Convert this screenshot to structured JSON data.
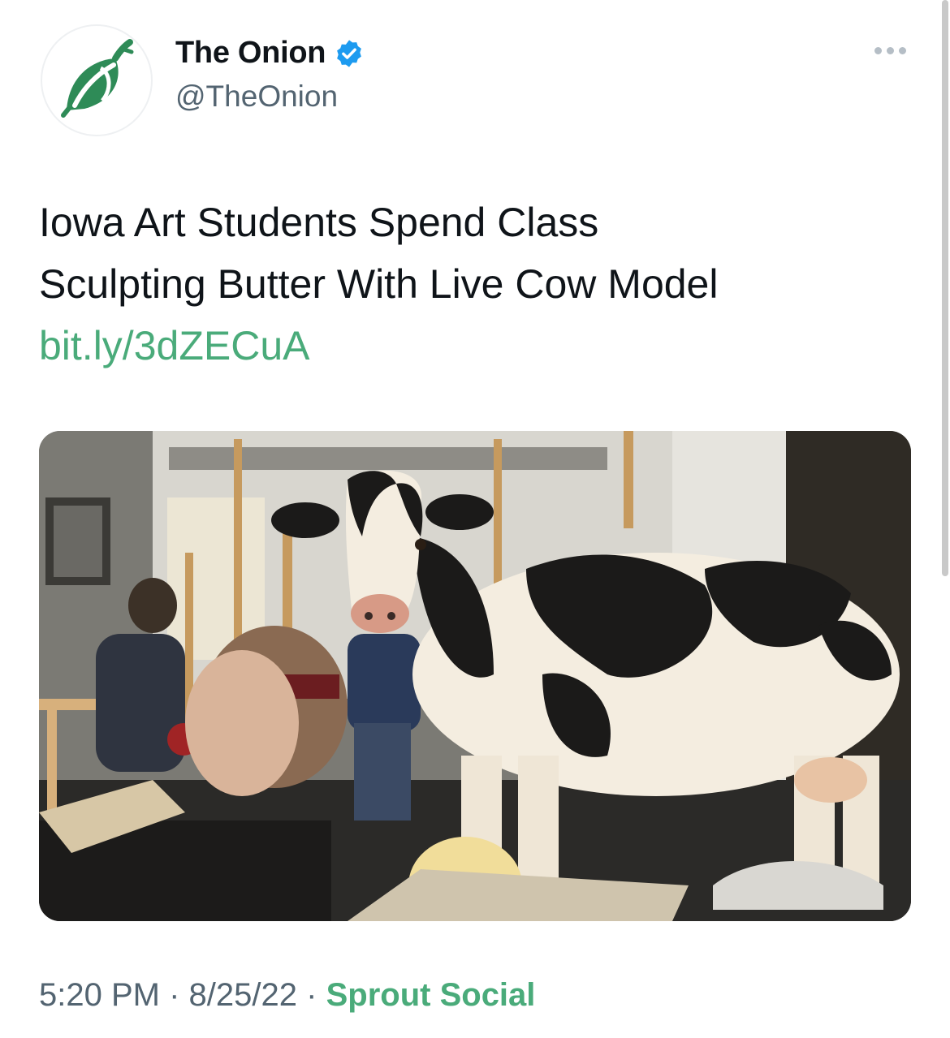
{
  "author": {
    "display_name": "The Onion",
    "handle": "@TheOnion",
    "verified": true,
    "avatar_icon": "onion-logo-icon",
    "brand_color": "#2e8b57"
  },
  "tweet": {
    "text_line1": "Iowa Art Students Spend Class",
    "text_line2": "Sculpting Butter With Live Cow Model",
    "link": "bit.ly/3dZECuA",
    "link_color": "#4aab7a"
  },
  "media": {
    "description_icon": "photo-cow-art-class"
  },
  "meta": {
    "time": "5:20 PM",
    "separator": "·",
    "date": "8/25/22",
    "source": "Sprout Social"
  },
  "menu": {
    "icon": "more-options-icon"
  }
}
